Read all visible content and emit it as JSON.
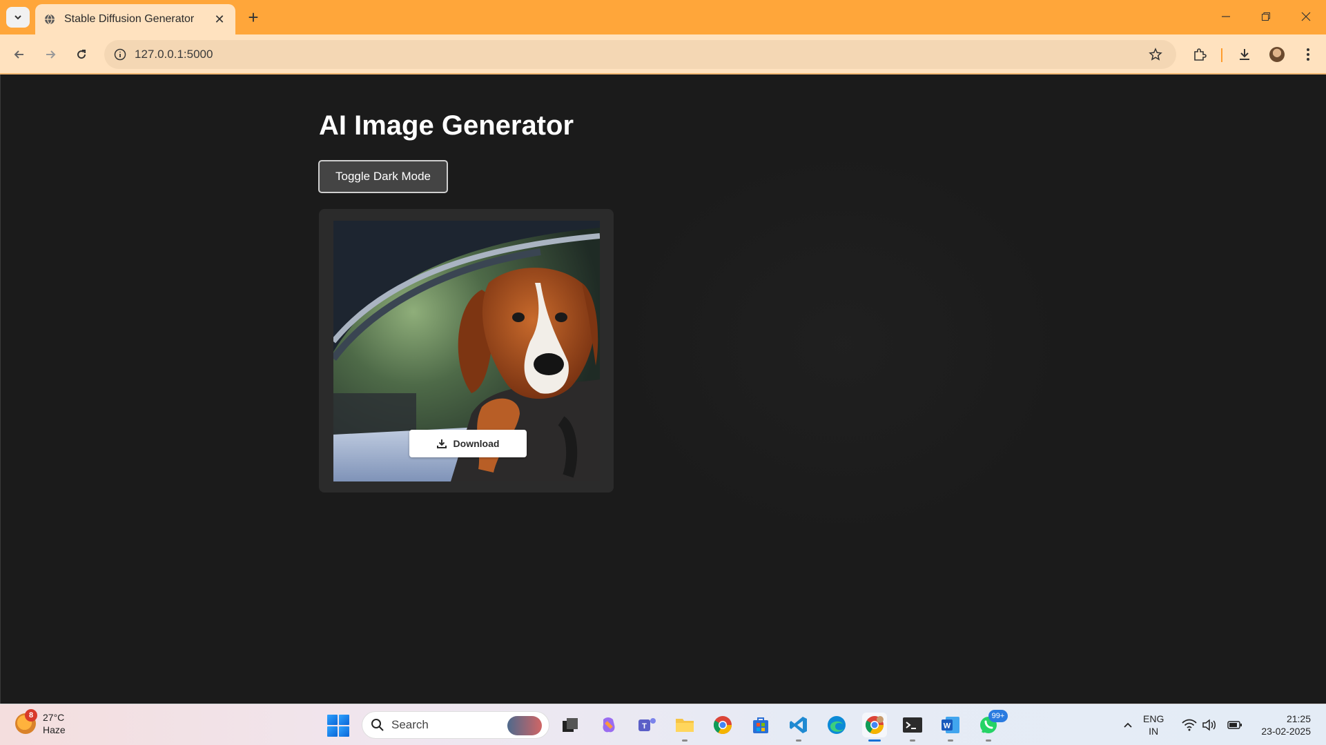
{
  "browser": {
    "tab_title": "Stable Diffusion Generator",
    "tab_close": "✕",
    "new_tab": "+",
    "url": "127.0.0.1:5000"
  },
  "page": {
    "heading": "AI Image Generator",
    "toggle_button": "Toggle Dark Mode",
    "download_button": "Download",
    "image_subject": "dog looking out of a car window"
  },
  "taskbar": {
    "weather": {
      "temp": "27°C",
      "condition": "Haze",
      "badge": "8"
    },
    "search_placeholder": "Search",
    "apps": [
      {
        "name": "task-view"
      },
      {
        "name": "copilot"
      },
      {
        "name": "teams"
      },
      {
        "name": "file-explorer"
      },
      {
        "name": "chrome"
      },
      {
        "name": "microsoft-store"
      },
      {
        "name": "vscode"
      },
      {
        "name": "edge"
      },
      {
        "name": "chrome-profile"
      },
      {
        "name": "terminal"
      },
      {
        "name": "word"
      },
      {
        "name": "whatsapp",
        "badge": "99+"
      }
    ],
    "lang_line1": "ENG",
    "lang_line2": "IN",
    "time": "21:25",
    "date": "23-02-2025"
  },
  "colors": {
    "tabbar": "#ffa63a",
    "toolbar": "#ffe2bf",
    "page_bg": "#1b1b1b",
    "card_bg": "#2b2b2b",
    "button_bg": "#444444"
  }
}
